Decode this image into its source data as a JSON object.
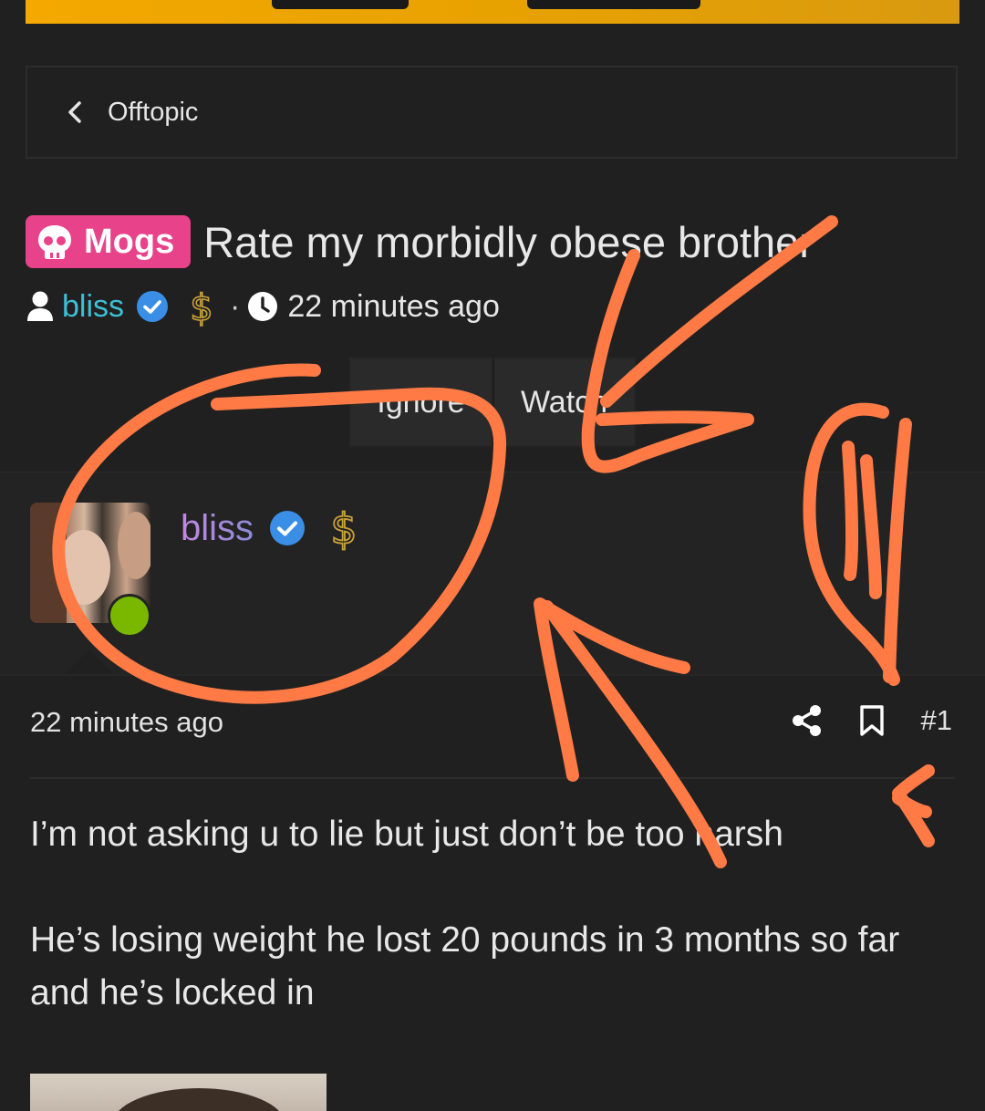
{
  "breadcrumb": {
    "label": "Offtopic"
  },
  "thread": {
    "prefix": "Mogs",
    "title": "Rate my morbidly obese brother",
    "author": "bliss",
    "separator": "·",
    "time": "22 minutes ago"
  },
  "buttons": {
    "ignore": "Ignore",
    "watch": "Watch"
  },
  "post": {
    "username": "bliss",
    "time": "22 minutes ago",
    "number": "#1",
    "paragraphs": [
      "I’m not asking u to lie but just don’t be too harsh",
      "He’s losing weight he lost 20 pounds in 3 months so far and he’s locked in"
    ]
  },
  "icons": {
    "back": "chevron-left-icon",
    "prefix": "skull-icon",
    "user": "user-icon",
    "verified": "verified-badge-icon",
    "dollar": "dollar-icon",
    "clock": "clock-icon",
    "share": "share-icon",
    "bookmark": "bookmark-icon"
  },
  "colors": {
    "background": "#202020",
    "prefix_bg": "#e8428a",
    "username_link": "#3cc0d6",
    "verified": "#3a8ee6",
    "dollar": "#c9a13a",
    "online": "#7ab800",
    "annotation": "#ff7a45"
  }
}
